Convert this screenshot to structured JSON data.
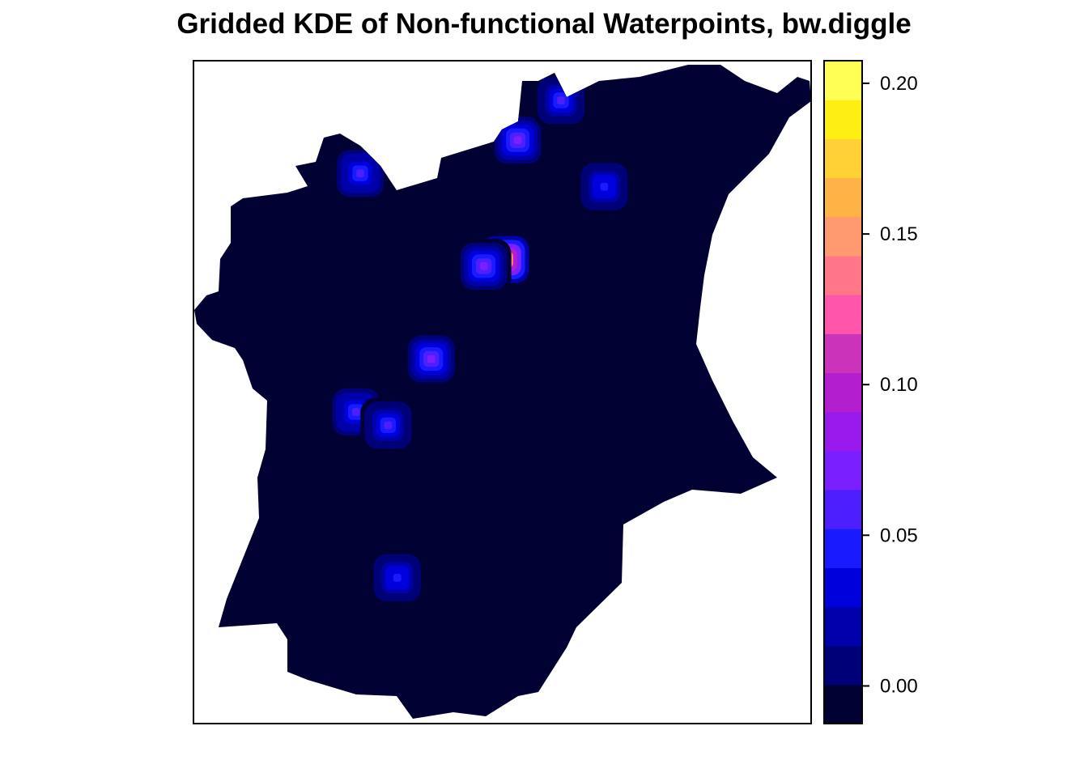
{
  "chart_data": {
    "type": "heatmap",
    "title": "Gridded KDE of Non-functional Waterpoints, bw.diggle",
    "xlabel": "",
    "ylabel": "",
    "legend": {
      "position": "right",
      "min": -0.0125,
      "max": 0.2075,
      "ticks": [
        "0.00",
        "0.05",
        "0.10",
        "0.15",
        "0.20"
      ],
      "tick_values": [
        0.0,
        0.05,
        0.1,
        0.15,
        0.2
      ],
      "colors": [
        "#000033",
        "#000077",
        "#0000AA",
        "#0000DD",
        "#1A1AFF",
        "#4D1FFF",
        "#7A1FFF",
        "#9A1AEE",
        "#B31ECF",
        "#CC33BB",
        "#FF55AA",
        "#FF7788",
        "#FF9970",
        "#FFB347",
        "#FFD033",
        "#FFEE11",
        "#FFFF55"
      ]
    },
    "background_color": "#000033",
    "hotspots": [
      {
        "x": 0.505,
        "y": 0.7,
        "value": 0.2
      },
      {
        "x": 0.47,
        "y": 0.69,
        "value": 0.08
      },
      {
        "x": 0.385,
        "y": 0.55,
        "value": 0.09
      },
      {
        "x": 0.263,
        "y": 0.47,
        "value": 0.07
      },
      {
        "x": 0.315,
        "y": 0.45,
        "value": 0.06
      },
      {
        "x": 0.33,
        "y": 0.22,
        "value": 0.05
      },
      {
        "x": 0.27,
        "y": 0.83,
        "value": 0.07
      },
      {
        "x": 0.525,
        "y": 0.88,
        "value": 0.08
      },
      {
        "x": 0.595,
        "y": 0.94,
        "value": 0.06
      },
      {
        "x": 0.665,
        "y": 0.81,
        "value": 0.05
      }
    ]
  }
}
